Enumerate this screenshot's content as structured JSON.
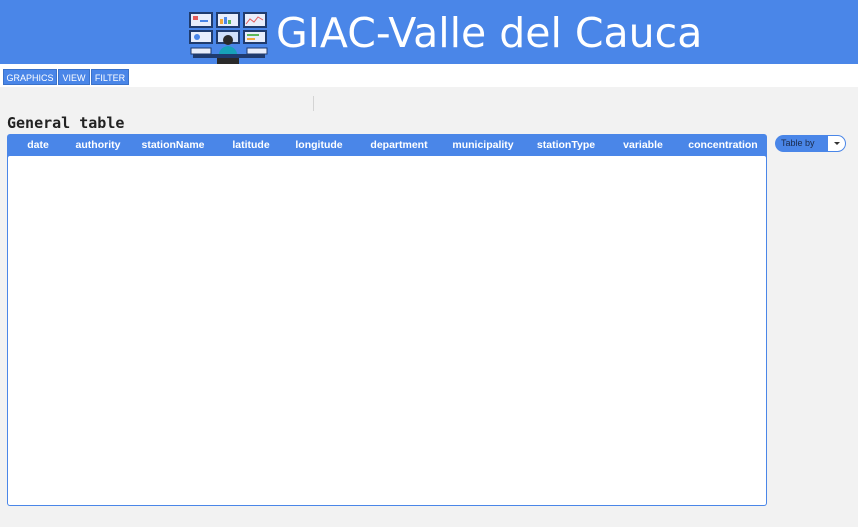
{
  "header": {
    "title": "GIAC-Valle del Cauca",
    "logo_icon": "control-room-monitors-icon"
  },
  "menu": [
    {
      "label": "GRAPHICS"
    },
    {
      "label": "VIEW"
    },
    {
      "label": "FILTER"
    }
  ],
  "section": {
    "title": "General table"
  },
  "table": {
    "columns": [
      "date",
      "authority",
      "stationName",
      "latitude",
      "longitude",
      "department",
      "municipality",
      "stationType",
      "variable",
      "concentration"
    ],
    "rows": []
  },
  "table_by": {
    "label": "Table by",
    "icon": "chevron-down-icon"
  },
  "colors": {
    "accent": "#4a86e8",
    "background": "#f2f2f2"
  }
}
